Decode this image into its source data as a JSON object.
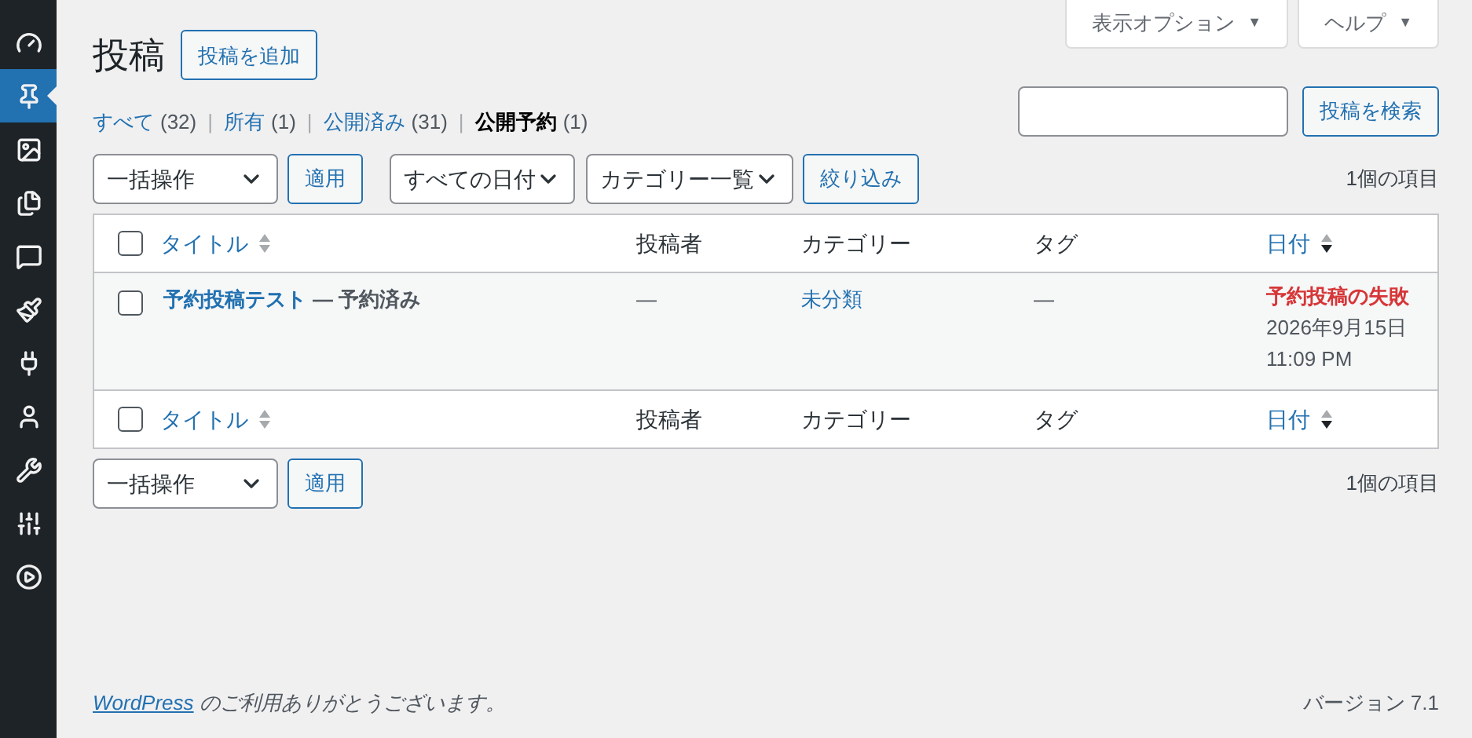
{
  "sidebar": {
    "items": [
      {
        "selected": false
      },
      {
        "selected": true
      },
      {
        "selected": false
      },
      {
        "selected": false
      },
      {
        "selected": false
      },
      {
        "selected": false
      },
      {
        "selected": false
      },
      {
        "selected": false
      },
      {
        "selected": false
      },
      {
        "selected": false
      },
      {
        "selected": false
      }
    ]
  },
  "screen_tabs": [
    {
      "label": "表示オプション",
      "caret": "▼"
    },
    {
      "label": "ヘルプ",
      "caret": "▼"
    }
  ],
  "page_title": "投稿",
  "add_button": "投稿を追加",
  "status_filters": [
    {
      "label": "すべて",
      "count": "(32)",
      "selected": false
    },
    {
      "separator": "|",
      "label": "所有",
      "count": "(1)",
      "selected": false
    },
    {
      "separator": "|",
      "label": "公開済み",
      "count": "(31)",
      "selected": false
    },
    {
      "separator": "|",
      "label": "公開予約",
      "count": "(1)",
      "selected": true
    }
  ],
  "search": {
    "button": "投稿を検索"
  },
  "top_toolbar": {
    "bulk_action": "一括操作",
    "apply": "適用",
    "date_filter": "すべての日付",
    "category_filter": "カテゴリー一覧",
    "filter_button": "絞り込み",
    "item_count": "1個の項目"
  },
  "table": {
    "header": {
      "checked": false,
      "columns": [
        {
          "label": "タイトル",
          "kind": "sortable",
          "sorted": false
        },
        {
          "label": "投稿者",
          "kind": "plain"
        },
        {
          "label": "カテゴリー",
          "kind": "plain"
        },
        {
          "label": "タグ",
          "kind": "plain"
        },
        {
          "label": "日付",
          "kind": "sortable",
          "sorted": true
        }
      ]
    },
    "rows": [
      {
        "checked": false,
        "title": "予約投稿テスト",
        "post_state": "— 予約済み",
        "author": "—",
        "category": "未分類",
        "tags": "—",
        "date_status": "予約投稿の失敗",
        "date": "2026年9月15日",
        "time": "11:09 PM"
      }
    ],
    "footer": {
      "checked": false,
      "columns": [
        {
          "label": "タイトル",
          "kind": "sortable",
          "sorted": false
        },
        {
          "label": "投稿者",
          "kind": "plain"
        },
        {
          "label": "カテゴリー",
          "kind": "plain"
        },
        {
          "label": "タグ",
          "kind": "plain"
        },
        {
          "label": "日付",
          "kind": "sortable",
          "sorted": true
        }
      ]
    }
  },
  "bottom_toolbar": {
    "bulk_action": "一括操作",
    "apply": "適用",
    "item_count": "1個の項目"
  },
  "footer": {
    "link": "WordPress",
    "text": "のご利用ありがとうございます。",
    "version": "バージョン 7.1"
  }
}
